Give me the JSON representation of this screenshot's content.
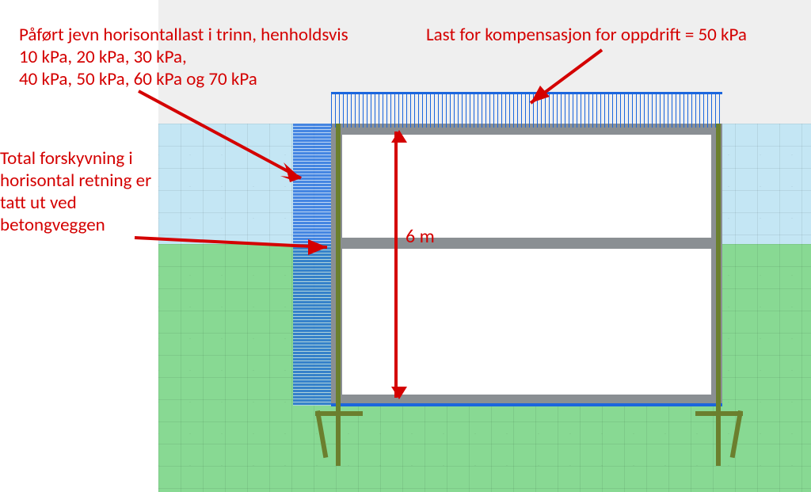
{
  "annotations": {
    "horizontal_load": "Påført jevn horisontallast i trinn, henholdsvis\n10 kPa, 20 kPa, 30 kPa,\n40 kPa, 50 kPa, 60 kPa og 70 kPa",
    "buoyancy_load": "Last for kompensasjon for oppdrift = 50 kPa",
    "displacement_note": "Total forskyvning i horisontal retning er tatt ut ved betongveggen"
  },
  "dimension": {
    "height_label": "6 m"
  },
  "loads": {
    "horizontal_steps_kPa": [
      10,
      20,
      30,
      40,
      50,
      60,
      70
    ],
    "buoyancy_compensation_kPa": 50,
    "culvert_height_m": 6
  },
  "colors": {
    "annotation": "#d40000",
    "concrete": "#8a8f93",
    "load_blue": "#1b66dd",
    "upper_soil": "#c4e6f4",
    "lower_soil": "#88d993",
    "sheet_pile": "#6b7f2e"
  },
  "icons": {
    "arrow": "arrow-icon"
  }
}
